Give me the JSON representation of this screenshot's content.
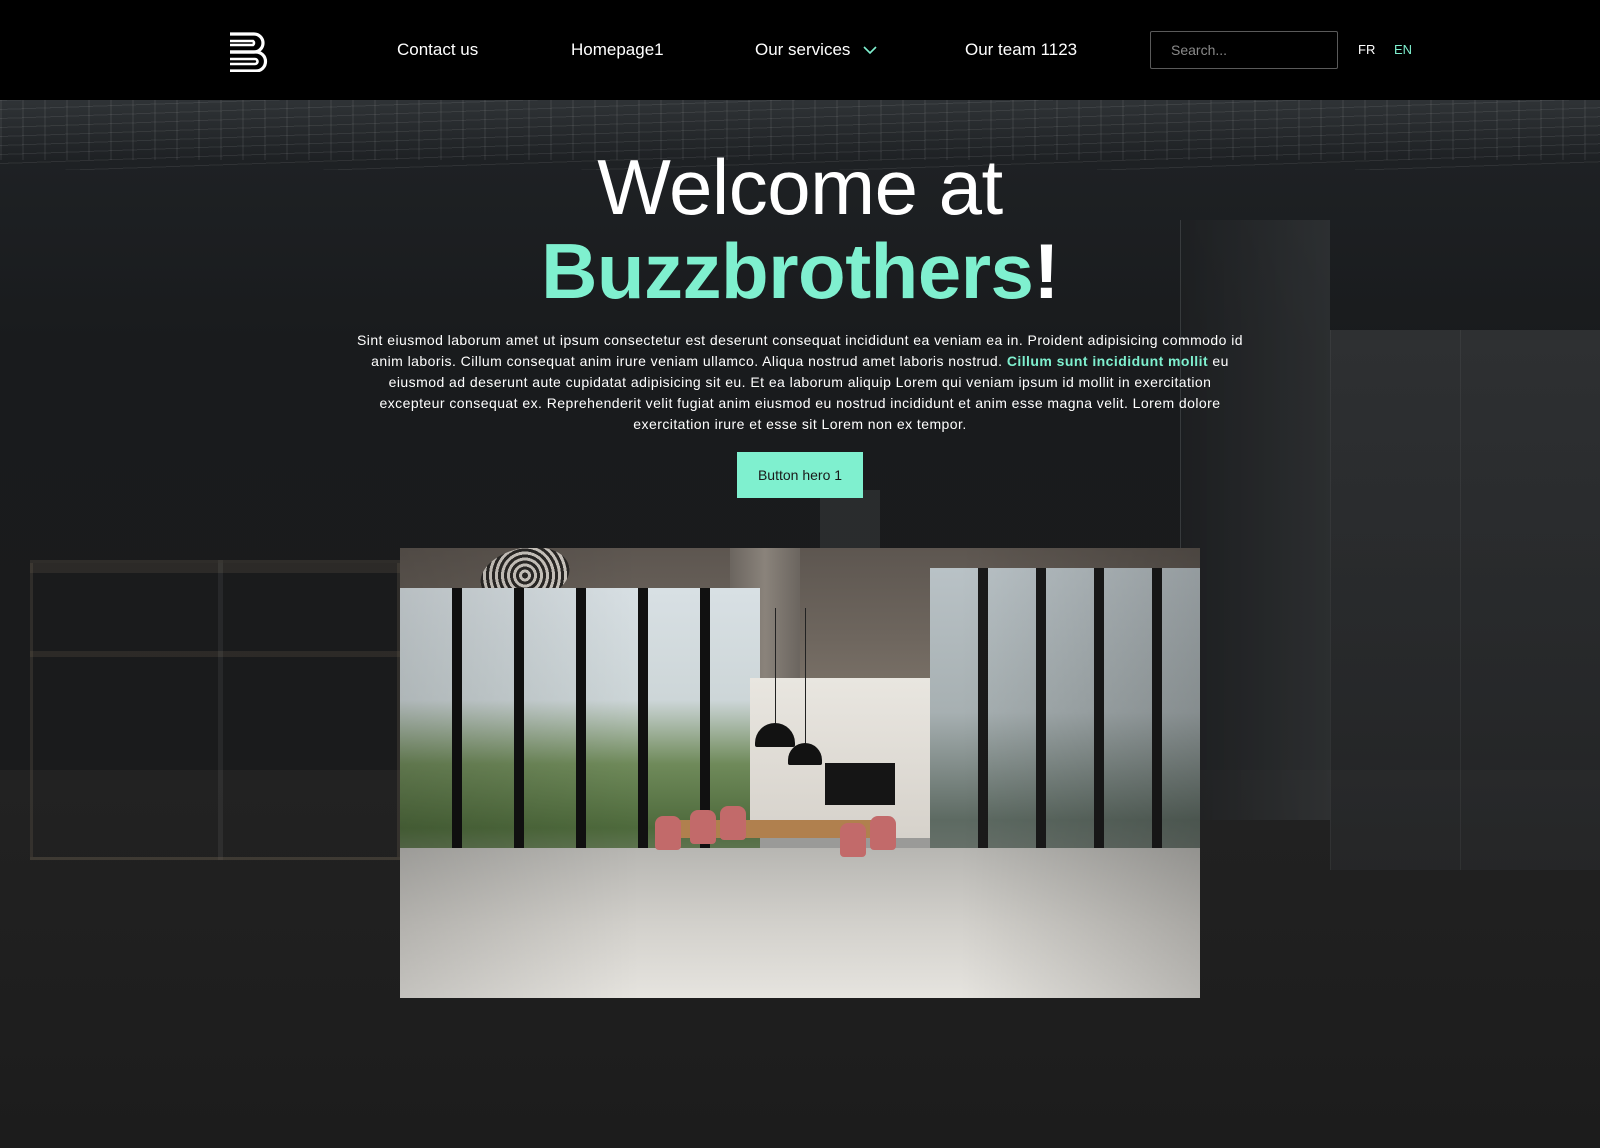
{
  "header": {
    "logo_icon": "buzzbrothers-b-logo",
    "nav": [
      {
        "label": "Contact us"
      },
      {
        "label": "Homepage1"
      },
      {
        "label": "Our services",
        "has_dropdown": true,
        "dropdown_icon": "chevron-down-icon"
      },
      {
        "label": "Our team 1123"
      }
    ],
    "search": {
      "placeholder": "Search...",
      "value": ""
    },
    "languages": [
      {
        "label": "FR",
        "active": false
      },
      {
        "label": "EN",
        "active": true
      }
    ]
  },
  "hero": {
    "title_line1": "Welcome at",
    "title_brand": "Buzzbrothers",
    "title_suffix": "!",
    "paragraph_part1": "Sint eiusmod laborum amet ut ipsum consectetur est deserunt consequat incididunt ea veniam ea in. Proident adipisicing commodo id anim laboris. Cillum consequat anim irure veniam ullamco. Aliqua nostrud amet laboris nostrud. ",
    "paragraph_highlight": "Cillum sunt incididunt mollit",
    "paragraph_part2": " eu eiusmod ad deserunt aute cupidatat adipisicing sit eu. Et ea laborum aliquip Lorem qui veniam ipsum id mollit in exercitation excepteur consequat ex. Reprehenderit velit fugiat anim eiusmod eu nostrud incididunt et anim esse magna velit. Lorem dolore exercitation irure et esse sit Lorem non ex tempor.",
    "button_label": "Button hero 1",
    "image_icon": "office-meeting-room-photo"
  },
  "colors": {
    "accent": "#7ff0cf",
    "header_bg": "#000000",
    "text": "#ffffff"
  }
}
